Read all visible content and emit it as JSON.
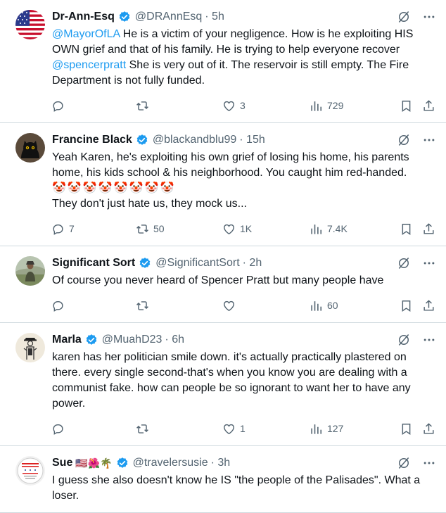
{
  "tweets": [
    {
      "name": "Dr-Ann-Esq",
      "handle": "@DRAnnEsq",
      "time": "· 5h",
      "emojis": "",
      "text_parts": [
        {
          "t": "@MayorOfLA",
          "mention": true
        },
        {
          "t": " He is a victim of your negligence.  How is he exploiting HIS OWN grief and that of his family. He is trying to help everyone recover ",
          "mention": false
        },
        {
          "t": "@spencerpratt",
          "mention": true
        },
        {
          "t": " She is very out of it. The reservoir is still empty. The Fire Department is not fully funded.",
          "mention": false
        }
      ],
      "extra_line": "",
      "clowns": "",
      "replies": "",
      "retweets": "",
      "likes": "3",
      "views": "729",
      "avatar": "us-flag"
    },
    {
      "name": "Francine Black",
      "handle": "@blackandblu99",
      "time": "· 15h",
      "emojis": "",
      "text_parts": [
        {
          "t": "Yeah Karen, he's exploiting his own grief of losing his home, his parents home, his kids school & his neighborhood. You caught him red-handed.",
          "mention": false
        }
      ],
      "clowns": "🤡🤡🤡🤡🤡🤡🤡🤡",
      "extra_line": "They don't just hate us, they mock us...",
      "replies": "7",
      "retweets": "50",
      "likes": "1K",
      "views": "7.4K",
      "avatar": "black-cat"
    },
    {
      "name": "Significant Sort",
      "handle": "@SignificantSort",
      "time": "· 2h",
      "emojis": "",
      "text_parts": [
        {
          "t": "Of course you never heard of Spencer Pratt but many people have",
          "mention": false
        }
      ],
      "clowns": "",
      "extra_line": "",
      "replies": "",
      "retweets": "",
      "likes": "",
      "views": "60",
      "avatar": "person-outdoors"
    },
    {
      "name": "Marla",
      "handle": "@MuahD23",
      "time": "· 6h",
      "emojis": "",
      "text_parts": [
        {
          "t": "karen has her politician smile down.  it's actually practically plastered on there.  every single second-that's when you know you are dealing with a communist fake.  how can people be so ignorant to want her to have any power.",
          "mention": false
        }
      ],
      "clowns": "",
      "extra_line": "",
      "replies": "",
      "retweets": "",
      "likes": "1",
      "views": "127",
      "avatar": "figure-drawing"
    },
    {
      "name": "Sue",
      "handle": "@travelersusie",
      "time": "· 3h",
      "emojis": "🇺🇸🌺🌴",
      "text_parts": [
        {
          "t": "I guess she also doesn't know he IS \"the people of the Palisades\". What a loser.",
          "mention": false
        }
      ],
      "clowns": "",
      "extra_line": "",
      "replies": "",
      "retweets": "",
      "likes": "",
      "views": "",
      "avatar": "politicians-button"
    }
  ],
  "icons": {
    "verified": "verified-badge-icon",
    "grok": "grok-icon",
    "more": "more-icon",
    "reply": "reply-icon",
    "retweet": "retweet-icon",
    "like": "like-icon",
    "views": "views-icon",
    "bookmark": "bookmark-icon",
    "share": "share-icon"
  },
  "colors": {
    "mention": "#1d9bf0",
    "verified": "#1d9bf0",
    "secondary_text": "#536471"
  }
}
